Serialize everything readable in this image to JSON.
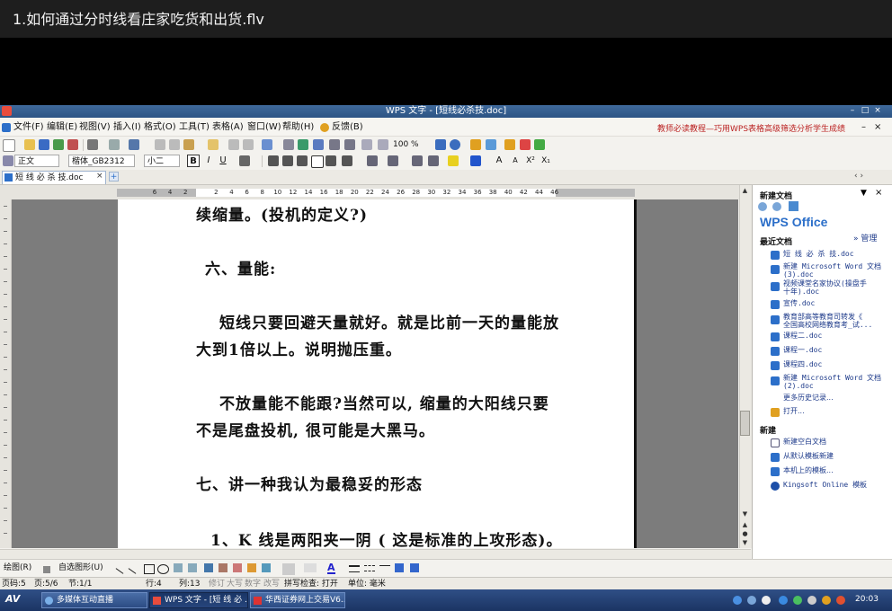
{
  "video": {
    "title": "1.如何通过分时线看庄家吃货和出货.flv"
  },
  "window": {
    "title": "WPS 文字 - [短线必杀技.doc]",
    "controls": [
      "–",
      "□",
      "×"
    ]
  },
  "menu": {
    "items": [
      "文件(F)",
      "编辑(E)",
      "视图(V)",
      "插入(I)",
      "格式(O)",
      "工具(T)",
      "表格(A)",
      "窗口(W)",
      "帮助(H)",
      "反馈(B)"
    ],
    "ad_text": "教师必读教程—巧用WPS表格高级筛选分析学生成绩",
    "right_controls": [
      "–",
      "×"
    ]
  },
  "format": {
    "style": "正文",
    "font": "楷体_GB2312",
    "size": "小二",
    "zoom": "100 %",
    "bold_label": "B",
    "italic_label": "I",
    "underline_label": "U"
  },
  "tab": {
    "label": "短 线 必 杀 技.doc",
    "close": "×",
    "add": "+"
  },
  "ruler": {
    "ticks": [
      "6",
      "4",
      "2",
      "",
      "2",
      "4",
      "6",
      "8",
      "10",
      "12",
      "14",
      "16",
      "18",
      "20",
      "22",
      "24",
      "26",
      "28",
      "30",
      "32",
      "34",
      "36",
      "38",
      "40",
      "42",
      "44",
      "46"
    ]
  },
  "document": {
    "lines": [
      "续缩量。(投机的定义?)",
      "六、量能:",
      "短线只要回避天量就好。就是比前一天的量能放",
      "大到1倍以上。说明抛压重。",
      "不放量能不能跟?当然可以, 缩量的大阳线只要",
      "不是尾盘投机, 很可能是大黑马。",
      "七、讲一种我认为最稳妥的形态",
      "1、K 线是两阳夹一阴 ( 这是标准的上攻形态)。"
    ]
  },
  "taskpane": {
    "title": "新建文档",
    "logo": "WPS Office",
    "recent_header": "最近文档",
    "manage": "» 管理",
    "recent": [
      "短 线 必 杀 技.doc",
      "新建 Microsoft Word 文档",
      "(3).doc",
      "视频课堂名家协议(操盘手",
      "十年).doc",
      "宣传.doc",
      "教育部高等教育司转发《",
      "全国高校网络教育考_试...",
      "课程二.doc",
      "课程一.doc",
      "课程四.doc",
      "新建 Microsoft Word 文档",
      "(2).doc",
      "更多历史记录..."
    ],
    "open": "打开...",
    "new_header": "新建",
    "new_items": [
      "新建空白文档",
      "从默认模板新建",
      "本机上的模板...",
      "Kingsoft Online 模板"
    ]
  },
  "drawbar": {
    "draw": "绘图(R)",
    "autoshape": "自选图形(U)"
  },
  "status": {
    "page_code": "页码:5",
    "page": "页:5/6",
    "section": "节:1/1",
    "row": "行:4",
    "col": "列:13",
    "rev": "修订",
    "caps": "大写",
    "num": "数字",
    "ovr": "改写",
    "spell": "拼写检查: 打开",
    "unit": "单位: 毫米"
  },
  "taskbar": {
    "start": "AV",
    "buttons": [
      "多媒体互动直播",
      "WPS 文字 - [短 线 必 ...",
      "华西证券网上交易V6..."
    ],
    "clock": "20:03"
  },
  "colors": {
    "title_bar": "#2c5383",
    "accent": "#2c6fc9",
    "ad": "#b22222",
    "taskbar": "#1b3463"
  }
}
